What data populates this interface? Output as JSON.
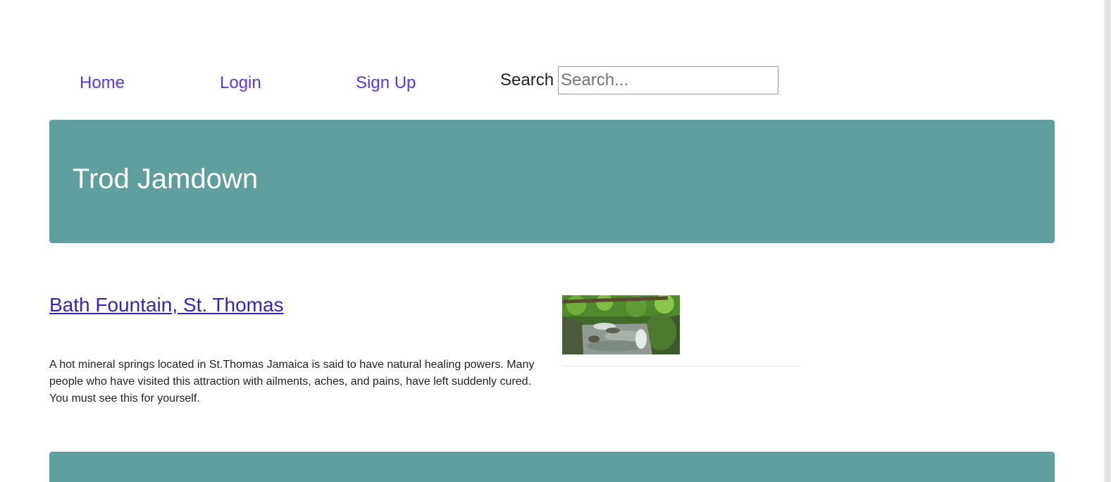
{
  "nav": {
    "home_label": "Home",
    "login_label": "Login",
    "signup_label": "Sign Up",
    "search_label": "Search",
    "search_placeholder": "Search...",
    "search_value": ""
  },
  "hero": {
    "title": "Trod Jamdown"
  },
  "article": {
    "title": "Bath Fountain, St. Thomas",
    "description": "A hot mineral springs located in St.Thomas Jamaica is said to have natural healing powers. Many people who have visited this attraction with ailments, aches, and pains, have left suddenly cured. You must see this for yourself.",
    "image_icon": "waterfall-stream-photo"
  },
  "colors": {
    "accent_teal": "#5f9f9e",
    "link_purple": "#5a33f5",
    "title_link": "#3a24b3"
  }
}
